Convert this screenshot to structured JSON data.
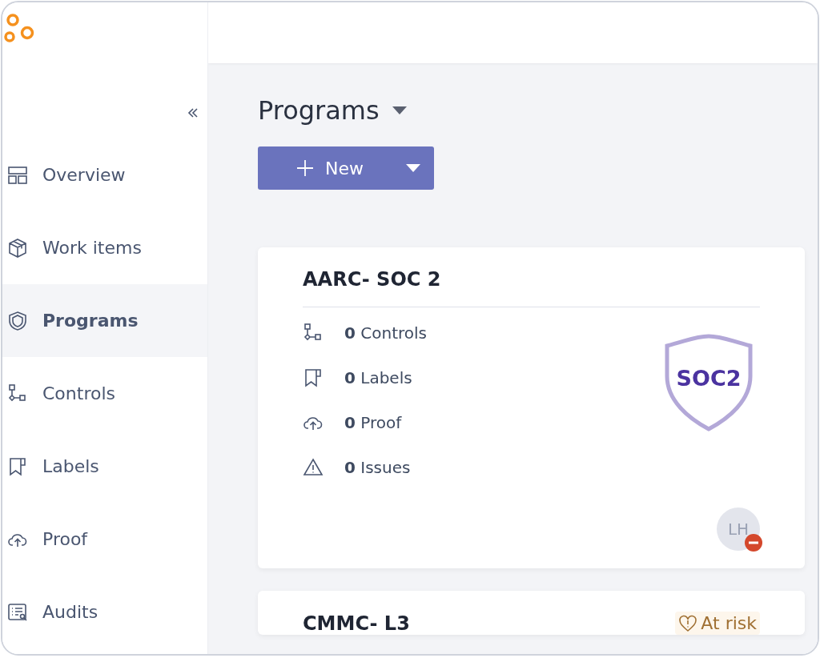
{
  "sidebar": {
    "items": [
      {
        "label": "Overview",
        "selected": false
      },
      {
        "label": "Work items",
        "selected": false
      },
      {
        "label": "Programs",
        "selected": true
      },
      {
        "label": "Controls",
        "selected": false
      },
      {
        "label": "Labels",
        "selected": false
      },
      {
        "label": "Proof",
        "selected": false
      },
      {
        "label": "Audits",
        "selected": false
      }
    ]
  },
  "page": {
    "title": "Programs",
    "new_button": "New"
  },
  "programs": [
    {
      "title": "AARC- SOC 2",
      "stats": [
        "**0** Controls",
        "**0** Labels",
        "**0** Proof",
        "**0** Issues"
      ],
      "badge": "SOC2",
      "avatar": {
        "initials": "LH",
        "do_not_disturb": true
      }
    },
    {
      "title": "CMMC- L3",
      "status": "At risk"
    }
  ]
}
